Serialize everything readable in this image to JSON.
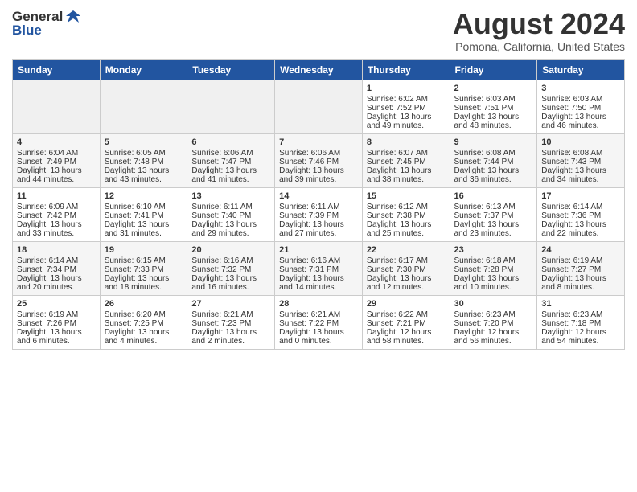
{
  "header": {
    "logo_general": "General",
    "logo_blue": "Blue",
    "month": "August 2024",
    "location": "Pomona, California, United States"
  },
  "weekdays": [
    "Sunday",
    "Monday",
    "Tuesday",
    "Wednesday",
    "Thursday",
    "Friday",
    "Saturday"
  ],
  "weeks": [
    [
      {
        "day": "",
        "empty": true
      },
      {
        "day": "",
        "empty": true
      },
      {
        "day": "",
        "empty": true
      },
      {
        "day": "",
        "empty": true
      },
      {
        "day": "1",
        "sunrise": "6:02 AM",
        "sunset": "7:52 PM",
        "daylight": "13 hours and 49 minutes."
      },
      {
        "day": "2",
        "sunrise": "6:03 AM",
        "sunset": "7:51 PM",
        "daylight": "13 hours and 48 minutes."
      },
      {
        "day": "3",
        "sunrise": "6:03 AM",
        "sunset": "7:50 PM",
        "daylight": "13 hours and 46 minutes."
      }
    ],
    [
      {
        "day": "4",
        "sunrise": "6:04 AM",
        "sunset": "7:49 PM",
        "daylight": "13 hours and 44 minutes."
      },
      {
        "day": "5",
        "sunrise": "6:05 AM",
        "sunset": "7:48 PM",
        "daylight": "13 hours and 43 minutes."
      },
      {
        "day": "6",
        "sunrise": "6:06 AM",
        "sunset": "7:47 PM",
        "daylight": "13 hours and 41 minutes."
      },
      {
        "day": "7",
        "sunrise": "6:06 AM",
        "sunset": "7:46 PM",
        "daylight": "13 hours and 39 minutes."
      },
      {
        "day": "8",
        "sunrise": "6:07 AM",
        "sunset": "7:45 PM",
        "daylight": "13 hours and 38 minutes."
      },
      {
        "day": "9",
        "sunrise": "6:08 AM",
        "sunset": "7:44 PM",
        "daylight": "13 hours and 36 minutes."
      },
      {
        "day": "10",
        "sunrise": "6:08 AM",
        "sunset": "7:43 PM",
        "daylight": "13 hours and 34 minutes."
      }
    ],
    [
      {
        "day": "11",
        "sunrise": "6:09 AM",
        "sunset": "7:42 PM",
        "daylight": "13 hours and 33 minutes."
      },
      {
        "day": "12",
        "sunrise": "6:10 AM",
        "sunset": "7:41 PM",
        "daylight": "13 hours and 31 minutes."
      },
      {
        "day": "13",
        "sunrise": "6:11 AM",
        "sunset": "7:40 PM",
        "daylight": "13 hours and 29 minutes."
      },
      {
        "day": "14",
        "sunrise": "6:11 AM",
        "sunset": "7:39 PM",
        "daylight": "13 hours and 27 minutes."
      },
      {
        "day": "15",
        "sunrise": "6:12 AM",
        "sunset": "7:38 PM",
        "daylight": "13 hours and 25 minutes."
      },
      {
        "day": "16",
        "sunrise": "6:13 AM",
        "sunset": "7:37 PM",
        "daylight": "13 hours and 23 minutes."
      },
      {
        "day": "17",
        "sunrise": "6:14 AM",
        "sunset": "7:36 PM",
        "daylight": "13 hours and 22 minutes."
      }
    ],
    [
      {
        "day": "18",
        "sunrise": "6:14 AM",
        "sunset": "7:34 PM",
        "daylight": "13 hours and 20 minutes."
      },
      {
        "day": "19",
        "sunrise": "6:15 AM",
        "sunset": "7:33 PM",
        "daylight": "13 hours and 18 minutes."
      },
      {
        "day": "20",
        "sunrise": "6:16 AM",
        "sunset": "7:32 PM",
        "daylight": "13 hours and 16 minutes."
      },
      {
        "day": "21",
        "sunrise": "6:16 AM",
        "sunset": "7:31 PM",
        "daylight": "13 hours and 14 minutes."
      },
      {
        "day": "22",
        "sunrise": "6:17 AM",
        "sunset": "7:30 PM",
        "daylight": "13 hours and 12 minutes."
      },
      {
        "day": "23",
        "sunrise": "6:18 AM",
        "sunset": "7:28 PM",
        "daylight": "13 hours and 10 minutes."
      },
      {
        "day": "24",
        "sunrise": "6:19 AM",
        "sunset": "7:27 PM",
        "daylight": "13 hours and 8 minutes."
      }
    ],
    [
      {
        "day": "25",
        "sunrise": "6:19 AM",
        "sunset": "7:26 PM",
        "daylight": "13 hours and 6 minutes."
      },
      {
        "day": "26",
        "sunrise": "6:20 AM",
        "sunset": "7:25 PM",
        "daylight": "13 hours and 4 minutes."
      },
      {
        "day": "27",
        "sunrise": "6:21 AM",
        "sunset": "7:23 PM",
        "daylight": "13 hours and 2 minutes."
      },
      {
        "day": "28",
        "sunrise": "6:21 AM",
        "sunset": "7:22 PM",
        "daylight": "13 hours and 0 minutes."
      },
      {
        "day": "29",
        "sunrise": "6:22 AM",
        "sunset": "7:21 PM",
        "daylight": "12 hours and 58 minutes."
      },
      {
        "day": "30",
        "sunrise": "6:23 AM",
        "sunset": "7:20 PM",
        "daylight": "12 hours and 56 minutes."
      },
      {
        "day": "31",
        "sunrise": "6:23 AM",
        "sunset": "7:18 PM",
        "daylight": "12 hours and 54 minutes."
      }
    ]
  ]
}
